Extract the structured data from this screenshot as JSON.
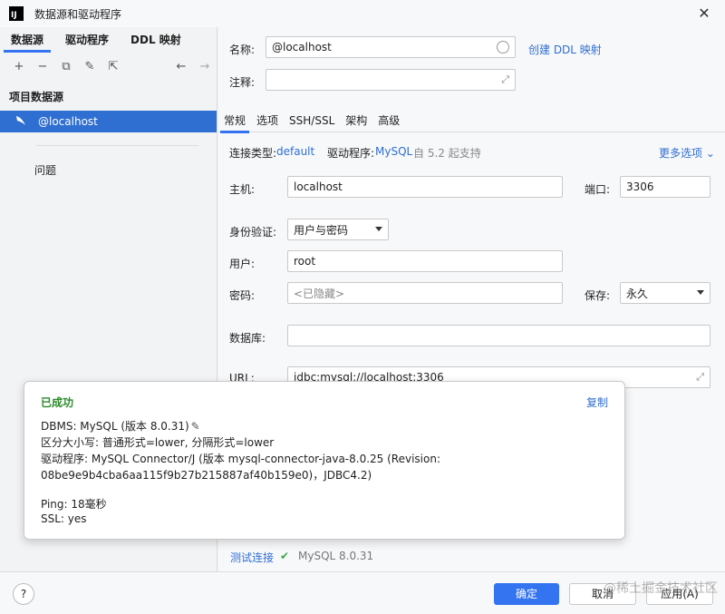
{
  "window": {
    "title": "数据源和驱动程序",
    "logo": "IJ"
  },
  "left": {
    "tabs": [
      "数据源",
      "驱动程序",
      "DDL 映射"
    ],
    "toolbar_icons": [
      "+",
      "−",
      "⧉",
      "✎",
      "⇱",
      "←",
      "→"
    ],
    "section_header": "项目数据源",
    "selected_item": "@localhost",
    "problems": "问题"
  },
  "form": {
    "name_label": "名称:",
    "name_value": "@localhost",
    "create_ddl_link": "创建 DDL 映射",
    "comment_label": "注释:",
    "tabs": [
      "常规",
      "选项",
      "SSH/SSL",
      "架构",
      "高级"
    ],
    "conn_type_label": "连接类型:",
    "conn_type_value": "default",
    "driver_label": "驱动程序:",
    "driver_value": "MySQL",
    "driver_note": "自 5.2 起支持",
    "more_options": "更多选项",
    "host_label": "主机:",
    "host_value": "localhost",
    "port_label": "端口:",
    "port_value": "3306",
    "auth_label": "身份验证:",
    "auth_value": "用户与密码",
    "user_label": "用户:",
    "user_value": "root",
    "password_label": "密码:",
    "password_placeholder": "<已隐藏>",
    "save_label": "保存:",
    "save_value": "永久",
    "database_label": "数据库:",
    "url_label": "URL:",
    "url_value": "jdbc:mysql://localhost:3306"
  },
  "popup": {
    "title": "已成功",
    "copy": "复制",
    "dbms": "DBMS: MySQL (版本 8.0.31)",
    "case": "区分大小写: 普通形式=lower, 分隔形式=lower",
    "driver_line1": "驱动程序: MySQL Connector/J (版本 mysql-connector-java-8.0.25 (Revision:",
    "driver_line2": "08be9e9b4cba6aa115f9b27b215887af40b159e0)，JDBC4.2)",
    "ping": "Ping: 18毫秒",
    "ssl": "SSL: yes"
  },
  "test": {
    "link": "测试连接",
    "result": "MySQL 8.0.31"
  },
  "bottom": {
    "help": "?",
    "ok": "确定",
    "cancel": "取消",
    "apply": "应用(A)"
  },
  "watermark": "@稀土掘金技术社区"
}
